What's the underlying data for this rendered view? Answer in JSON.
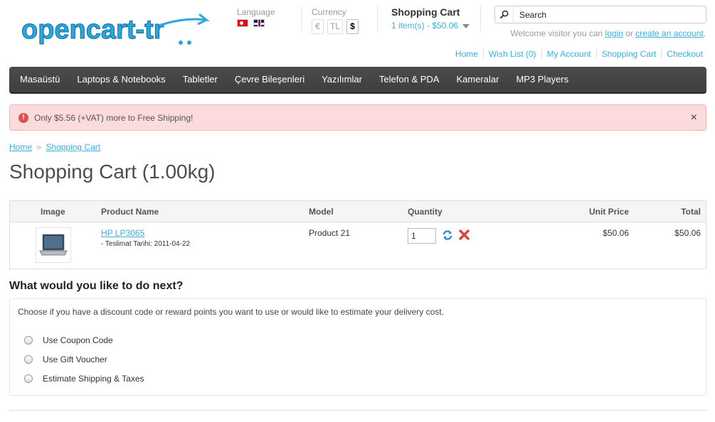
{
  "header": {
    "logo_text": "opencart-tr",
    "language_label": "Language",
    "currency_label": "Currency",
    "currencies": [
      "€",
      "TL",
      "$"
    ],
    "selected_currency": "$",
    "cart_title": "Shopping Cart",
    "cart_info": "1 item(s) - $50.06",
    "search_placeholder": "Search",
    "welcome_prefix": "Welcome visitor you can",
    "login_link": "login",
    "or_text": "or",
    "create_account_link": "create an account",
    "welcome_suffix": "."
  },
  "top_links": [
    "Home",
    "Wish List (0)",
    "My Account",
    "Shopping Cart",
    "Checkout"
  ],
  "menu": [
    "Masaüstü",
    "Laptops & Notebooks",
    "Tabletler",
    "Çevre Bileşenleri",
    "Yazılımlar",
    "Telefon & PDA",
    "Kameralar",
    "MP3 Players"
  ],
  "alert": {
    "message": "Only $5.56 (+VAT) more to Free Shipping!",
    "close": "×"
  },
  "breadcrumb": [
    "Home",
    "Shopping Cart"
  ],
  "breadcrumb_sep": "»",
  "page_title": "Shopping Cart  (1.00kg)",
  "table": {
    "headers": {
      "image": "Image",
      "name": "Product Name",
      "model": "Model",
      "quantity": "Quantity",
      "unit_price": "Unit Price",
      "total": "Total"
    },
    "rows": [
      {
        "name": "HP LP3065",
        "option": "- Teslimat Tarihi: 2011-04-22",
        "model": "Product 21",
        "quantity": "1",
        "unit_price": "$50.06",
        "total": "$50.06"
      }
    ]
  },
  "next": {
    "title": "What would you like to do next?",
    "intro": "Choose if you have a discount code or reward points you want to use or would like to estimate your delivery cost.",
    "options": [
      "Use Coupon Code",
      "Use Gift Voucher",
      "Estimate Shipping & Taxes"
    ]
  },
  "colors": {
    "link": "#38b0e3",
    "menu_bg": "#444444",
    "alert_bg": "#fbdbdb"
  }
}
